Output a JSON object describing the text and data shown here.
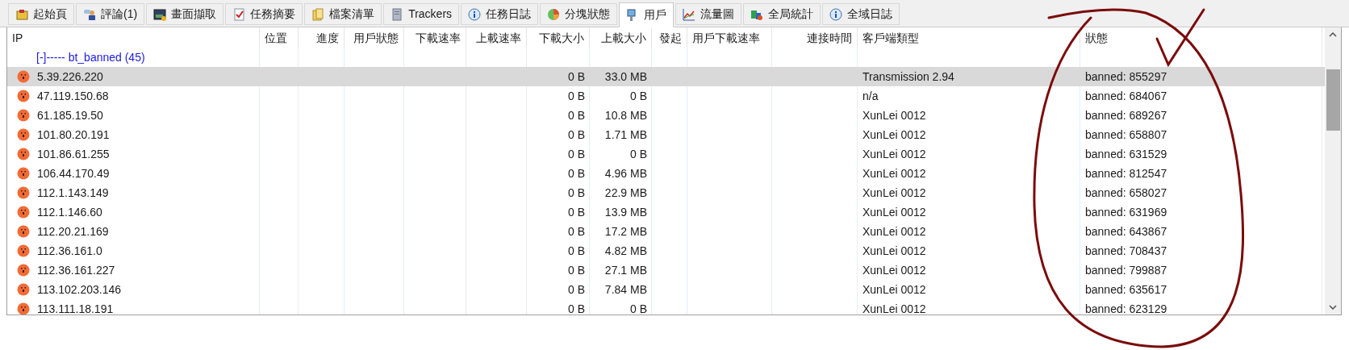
{
  "tabs": [
    {
      "label": "起始頁",
      "selected": false
    },
    {
      "label": "評論(1)",
      "selected": false
    },
    {
      "label": "畫面擷取",
      "selected": false
    },
    {
      "label": "任務摘要",
      "selected": false
    },
    {
      "label": "檔案清單",
      "selected": false
    },
    {
      "label": "Trackers",
      "selected": false
    },
    {
      "label": "任務日誌",
      "selected": false
    },
    {
      "label": "分塊狀態",
      "selected": false
    },
    {
      "label": "用戶",
      "selected": true
    },
    {
      "label": "流量圖",
      "selected": false
    },
    {
      "label": "全局統計",
      "selected": false
    },
    {
      "label": "全域日誌",
      "selected": false
    }
  ],
  "table": {
    "columns": [
      "IP",
      "位置",
      "進度",
      "用戶狀態",
      "下載速率",
      "上載速率",
      "下載大小",
      "上載大小",
      "發起",
      "用戶下載速率",
      "連接時間",
      "客戶端類型",
      "狀態"
    ],
    "group": {
      "label": "[-]----- bt_banned (45)",
      "expanded": true
    },
    "rows": [
      {
        "ip": "5.39.226.220",
        "download_size": "0 B",
        "upload_size": "33.0 MB",
        "client": "Transmission 2.94",
        "status": "banned: 855297",
        "selected": true
      },
      {
        "ip": "47.119.150.68",
        "download_size": "0 B",
        "upload_size": "0 B",
        "client": "n/a",
        "status": "banned: 684067",
        "selected": false
      },
      {
        "ip": "61.185.19.50",
        "download_size": "0 B",
        "upload_size": "10.8 MB",
        "client": "XunLei 0012",
        "status": "banned: 689267",
        "selected": false
      },
      {
        "ip": "101.80.20.191",
        "download_size": "0 B",
        "upload_size": "1.71 MB",
        "client": "XunLei 0012",
        "status": "banned: 658807",
        "selected": false
      },
      {
        "ip": "101.86.61.255",
        "download_size": "0 B",
        "upload_size": "0 B",
        "client": "XunLei 0012",
        "status": "banned: 631529",
        "selected": false
      },
      {
        "ip": "106.44.170.49",
        "download_size": "0 B",
        "upload_size": "4.96 MB",
        "client": "XunLei 0012",
        "status": "banned: 812547",
        "selected": false
      },
      {
        "ip": "112.1.143.149",
        "download_size": "0 B",
        "upload_size": "22.9 MB",
        "client": "XunLei 0012",
        "status": "banned: 658027",
        "selected": false
      },
      {
        "ip": "112.1.146.60",
        "download_size": "0 B",
        "upload_size": "13.9 MB",
        "client": "XunLei 0012",
        "status": "banned: 631969",
        "selected": false
      },
      {
        "ip": "112.20.21.169",
        "download_size": "0 B",
        "upload_size": "17.2 MB",
        "client": "XunLei 0012",
        "status": "banned: 643867",
        "selected": false
      },
      {
        "ip": "112.36.161.0",
        "download_size": "0 B",
        "upload_size": "4.82 MB",
        "client": "XunLei 0012",
        "status": "banned: 708437",
        "selected": false
      },
      {
        "ip": "112.36.161.227",
        "download_size": "0 B",
        "upload_size": "27.1 MB",
        "client": "XunLei 0012",
        "status": "banned: 799887",
        "selected": false
      },
      {
        "ip": "113.102.203.146",
        "download_size": "0 B",
        "upload_size": "7.84 MB",
        "client": "XunLei 0012",
        "status": "banned: 635617",
        "selected": false
      },
      {
        "ip": "113.111.18.191",
        "download_size": "0 B",
        "upload_size": "0 B",
        "client": "XunLei 0012",
        "status": "banned: 623129",
        "selected": false
      }
    ]
  },
  "annotation": {
    "kind": "circle-and-check"
  }
}
